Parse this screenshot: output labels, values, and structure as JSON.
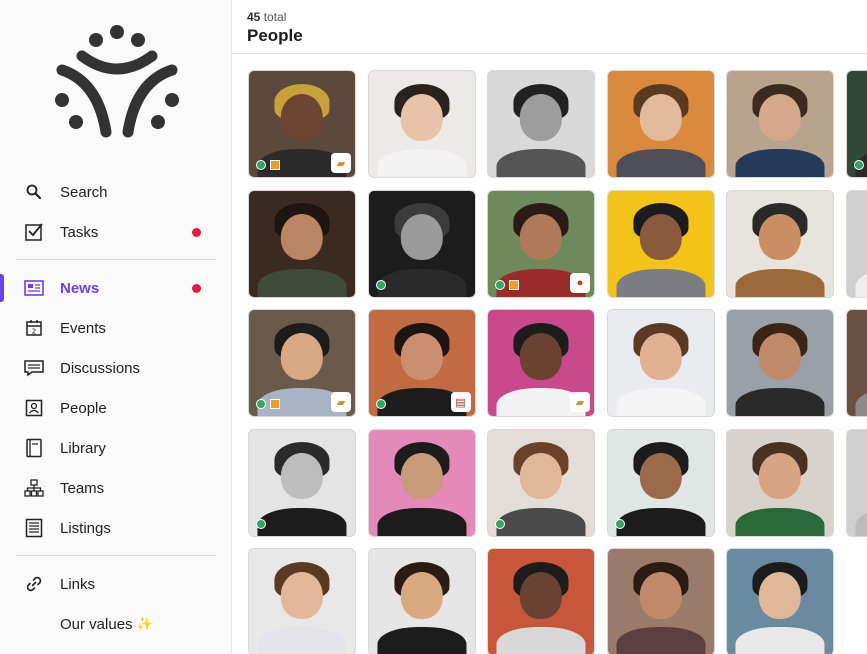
{
  "header": {
    "count_number": "45",
    "count_suffix": "total",
    "title": "People"
  },
  "sidebar": {
    "items": [
      {
        "label": "Search",
        "icon": "search-icon",
        "dot": false,
        "active": false
      },
      {
        "label": "Tasks",
        "icon": "checkbox-icon",
        "dot": true,
        "active": false
      },
      {
        "label": "News",
        "icon": "newspaper-icon",
        "dot": true,
        "active": true
      },
      {
        "label": "Events",
        "icon": "calendar-icon",
        "dot": false,
        "active": false
      },
      {
        "label": "Discussions",
        "icon": "chat-icon",
        "dot": false,
        "active": false
      },
      {
        "label": "People",
        "icon": "person-card-icon",
        "dot": false,
        "active": false
      },
      {
        "label": "Library",
        "icon": "book-icon",
        "dot": false,
        "active": false
      },
      {
        "label": "Teams",
        "icon": "org-chart-icon",
        "dot": false,
        "active": false
      },
      {
        "label": "Listings",
        "icon": "list-icon",
        "dot": false,
        "active": false
      },
      {
        "label": "Links",
        "icon": "link-icon",
        "dot": false,
        "active": false
      },
      {
        "label": "Our values",
        "icon": "",
        "dot": false,
        "active": false,
        "suffix": "✨"
      }
    ]
  },
  "colors": {
    "accent": "#6c3ff5",
    "notification": "#e8193c",
    "online": "#2fa865",
    "tag": "#f59a23"
  },
  "people": [
    {
      "bg": "#5b4a3c",
      "skin": "#6b4530",
      "hair": "#c9a13a",
      "shirt": "#2b2b2b",
      "online": true,
      "tag": true,
      "emoji": "bread-icon"
    },
    {
      "bg": "#eceae7",
      "skin": "#e7c3a8",
      "hair": "#2a221d",
      "shirt": "#f2f2f2",
      "online": false,
      "tag": false,
      "emoji": ""
    },
    {
      "bg": "#d9d9d9",
      "skin": "#9d9d9d",
      "hair": "#222222",
      "shirt": "#555555",
      "online": false,
      "tag": false,
      "emoji": ""
    },
    {
      "bg": "#d98a3c",
      "skin": "#e2b999",
      "hair": "#5a3a22",
      "shirt": "#4d5157",
      "online": false,
      "tag": false,
      "emoji": ""
    },
    {
      "bg": "#b8a48c",
      "skin": "#d4a888",
      "hair": "#3a2a20",
      "shirt": "#233a5a",
      "online": false,
      "tag": false,
      "emoji": ""
    },
    {
      "bg": "#2f4a3a",
      "skin": "#8a6048",
      "hair": "#1c1c1c",
      "shirt": "#2a2a2a",
      "online": true,
      "tag": false,
      "emoji": ""
    },
    {
      "bg": "#3b2a22",
      "skin": "#b98563",
      "hair": "#1d1510",
      "shirt": "#3f4a3a",
      "online": false,
      "tag": false,
      "emoji": ""
    },
    {
      "bg": "#1c1c1c",
      "skin": "#9a9a9a",
      "hair": "#3b3b3b",
      "shirt": "#2a2a2a",
      "online": true,
      "tag": false,
      "emoji": ""
    },
    {
      "bg": "#6f8a5a",
      "skin": "#b07a58",
      "hair": "#2a1c14",
      "shirt": "#9a2b2b",
      "online": true,
      "tag": true,
      "emoji": "apple-icon"
    },
    {
      "bg": "#f2c318",
      "skin": "#8a5a3c",
      "hair": "#1c1c1c",
      "shirt": "#7a7e82",
      "online": false,
      "tag": false,
      "emoji": ""
    },
    {
      "bg": "#e7e3dd",
      "skin": "#c98f62",
      "hair": "#2a2a2a",
      "shirt": "#9a6a3a",
      "online": false,
      "tag": false,
      "emoji": ""
    },
    {
      "bg": "#cfcfcf",
      "skin": "#b08a6a",
      "hair": "#3a2a20",
      "shirt": "#eeeeee",
      "online": false,
      "tag": false,
      "emoji": ""
    },
    {
      "bg": "#6a5a4a",
      "skin": "#d8a882",
      "hair": "#1c1c1c",
      "shirt": "#a8b4c4",
      "online": true,
      "tag": true,
      "emoji": "bread-icon"
    },
    {
      "bg": "#c26a42",
      "skin": "#c98f6e",
      "hair": "#1c1512",
      "shirt": "#1c1c1c",
      "online": true,
      "tag": false,
      "emoji": "notepad-icon"
    },
    {
      "bg": "#c84a8a",
      "skin": "#6a4230",
      "hair": "#1c1c1c",
      "shirt": "#f2f2f2",
      "online": false,
      "tag": false,
      "emoji": "bread-icon"
    },
    {
      "bg": "#e8ecef",
      "skin": "#e0b091",
      "hair": "#5a3a22",
      "shirt": "#f4f4f4",
      "online": false,
      "tag": false,
      "emoji": ""
    },
    {
      "bg": "#9aa0a8",
      "skin": "#c08a6a",
      "hair": "#3a2418",
      "shirt": "#2a2a2a",
      "online": false,
      "tag": false,
      "emoji": ""
    },
    {
      "bg": "#6a5040",
      "skin": "#c59a7a",
      "hair": "#2a1c14",
      "shirt": "#8a8a8a",
      "online": false,
      "tag": false,
      "emoji": ""
    },
    {
      "bg": "#e4e4e4",
      "skin": "#bdbdbd",
      "hair": "#2b2b2b",
      "shirt": "#1c1c1c",
      "online": true,
      "tag": false,
      "emoji": ""
    },
    {
      "bg": "#e48ab8",
      "skin": "#c99a78",
      "hair": "#1c1c1c",
      "shirt": "#1c1c1c",
      "online": false,
      "tag": false,
      "emoji": ""
    },
    {
      "bg": "#e2ddd8",
      "skin": "#e0b898",
      "hair": "#6a4228",
      "shirt": "#4a4a4a",
      "online": true,
      "tag": false,
      "emoji": ""
    },
    {
      "bg": "#dfe6e4",
      "skin": "#9a6a4a",
      "hair": "#1c1c1c",
      "shirt": "#1c1c1c",
      "online": true,
      "tag": false,
      "emoji": ""
    },
    {
      "bg": "#d8d2cc",
      "skin": "#d8a482",
      "hair": "#4a3220",
      "shirt": "#2a6a3a",
      "online": false,
      "tag": false,
      "emoji": ""
    },
    {
      "bg": "#cfcfcf",
      "skin": "#c4c4c4",
      "hair": "#8a8a8a",
      "shirt": "#bbbbbb",
      "online": false,
      "tag": false,
      "emoji": ""
    },
    {
      "bg": "#e8e8e8",
      "skin": "#e3b898",
      "hair": "#5a3a22",
      "shirt": "#e4e4ea",
      "online": false,
      "tag": false,
      "emoji": ""
    },
    {
      "bg": "#e6e6e6",
      "skin": "#d8a880",
      "hair": "#2a1c14",
      "shirt": "#1c1c1c",
      "online": false,
      "tag": false,
      "emoji": ""
    },
    {
      "bg": "#c8563a",
      "skin": "#6a4232",
      "hair": "#1c1c1c",
      "shirt": "#d8d8d8",
      "online": false,
      "tag": false,
      "emoji": ""
    },
    {
      "bg": "#9a7a68",
      "skin": "#c08a6a",
      "hair": "#2a1c14",
      "shirt": "#5a4040",
      "online": false,
      "tag": false,
      "emoji": ""
    },
    {
      "bg": "#6a8aa0",
      "skin": "#e0b898",
      "hair": "#1c1c1c",
      "shirt": "#e8e8e8",
      "online": false,
      "tag": false,
      "emoji": ""
    }
  ]
}
